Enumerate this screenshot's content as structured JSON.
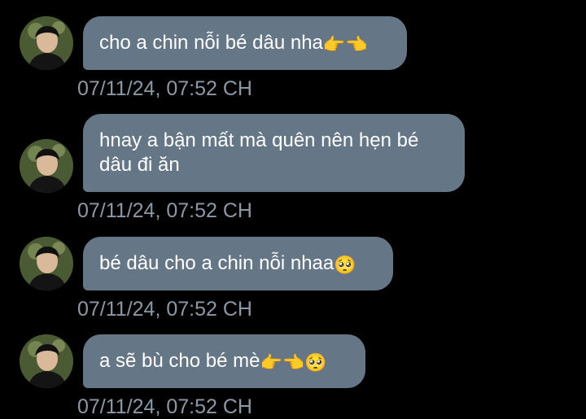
{
  "messages": [
    {
      "text": "cho a chin nỗi bé dâu nha",
      "emoji": "👉👈",
      "timestamp": "07/11/24, 07:52 CH"
    },
    {
      "text": "hnay a bận mất mà quên nên hẹn bé dâu đi ăn",
      "emoji": "",
      "timestamp": "07/11/24, 07:52 CH"
    },
    {
      "text": "bé dâu cho a chin nỗi nhaa",
      "emoji": "🥺",
      "timestamp": "07/11/24, 07:52 CH"
    },
    {
      "text": "a sẽ bù cho bé mè",
      "emoji": "👉👈🥺",
      "timestamp": "07/11/24, 07:52 CH"
    }
  ],
  "colors": {
    "background": "#000000",
    "bubble": "#657786",
    "bubble_text": "#ffffff",
    "timestamp": "#8b98a5"
  },
  "icons": {
    "avatar": "profile-photo"
  }
}
